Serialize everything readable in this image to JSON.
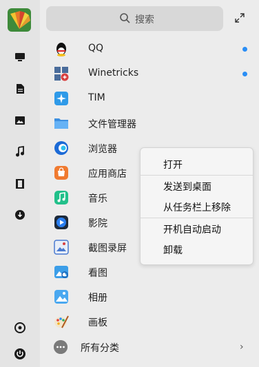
{
  "search": {
    "placeholder": "搜索"
  },
  "apps": [
    {
      "label": "QQ",
      "icon": "qq-icon",
      "new": true
    },
    {
      "label": "Winetricks",
      "icon": "winetricks-icon",
      "new": true
    },
    {
      "label": "TIM",
      "icon": "tim-icon",
      "new": false
    },
    {
      "label": "文件管理器",
      "icon": "file-manager-icon",
      "new": false
    },
    {
      "label": "浏览器",
      "icon": "browser-icon",
      "new": false
    },
    {
      "label": "应用商店",
      "icon": "app-store-icon",
      "new": false
    },
    {
      "label": "音乐",
      "icon": "music-icon",
      "new": false
    },
    {
      "label": "影院",
      "icon": "movie-icon",
      "new": false
    },
    {
      "label": "截图录屏",
      "icon": "screenshot-icon",
      "new": false
    },
    {
      "label": "看图",
      "icon": "image-viewer-icon",
      "new": false
    },
    {
      "label": "相册",
      "icon": "album-icon",
      "new": false
    },
    {
      "label": "画板",
      "icon": "drawing-board-icon",
      "new": false
    }
  ],
  "all_categories": {
    "label": "所有分类",
    "chevron": "›"
  },
  "context_menu": {
    "items": [
      "打开",
      "发送到桌面",
      "从任务栏上移除",
      "开机自动启动",
      "卸载"
    ]
  },
  "colors": {
    "accent": "#2a8ef5",
    "background": "#ececec",
    "sidebar": "#e4e4e4"
  }
}
